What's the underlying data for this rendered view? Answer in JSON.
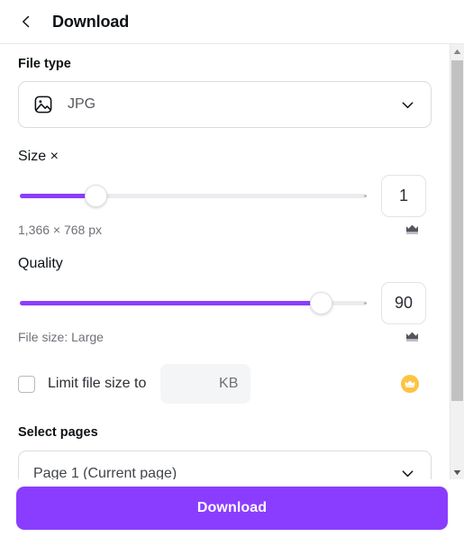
{
  "header": {
    "title": "Download",
    "back_icon": "chevron-left-icon"
  },
  "file_type": {
    "label": "File type",
    "icon": "image-file-icon",
    "value": "JPG",
    "chevron": "chevron-down-icon"
  },
  "size": {
    "label": "Size ×",
    "value": "1",
    "slider_percent": 22,
    "dimensions": "1,366 × 768 px",
    "crown_icon": "crown-icon"
  },
  "quality": {
    "label": "Quality",
    "value": "90",
    "slider_percent": 87,
    "file_size_text": "File size: Large",
    "crown_icon": "crown-icon"
  },
  "limit_file_size": {
    "label": "Limit file size to",
    "checked": false,
    "unit": "KB",
    "input_value": "",
    "pro_badge_icon": "crown-badge-icon"
  },
  "select_pages": {
    "label": "Select pages",
    "value": "Page 1 (Current page)",
    "chevron": "chevron-down-icon"
  },
  "footer": {
    "download_label": "Download"
  },
  "scrollbar": {
    "up_icon": "scroll-up-arrow-icon",
    "down_icon": "scroll-down-arrow-icon"
  },
  "colors": {
    "accent_purple": "#8b3dff",
    "gold": "#fcc442",
    "track_grey": "#ebecef",
    "text_dark": "#0d1216",
    "text_muted": "#6e7177"
  }
}
